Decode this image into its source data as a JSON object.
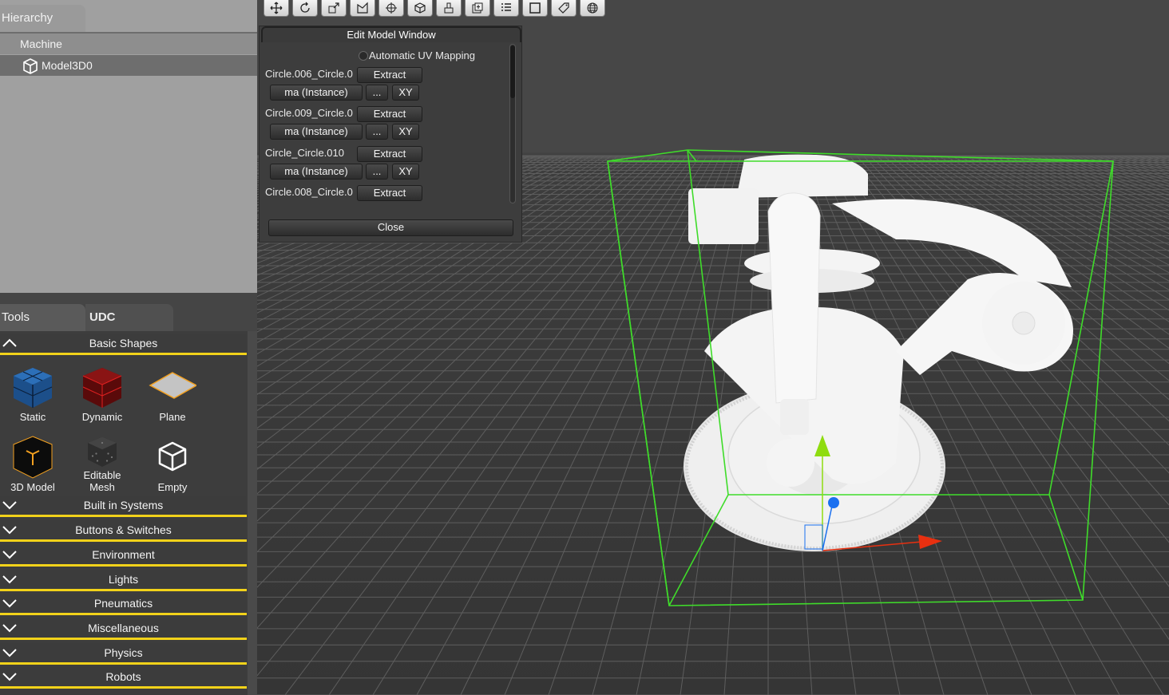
{
  "toolbar": {
    "tools": [
      {
        "icon": "move-icon"
      },
      {
        "icon": "rotate-icon"
      },
      {
        "icon": "scale-icon"
      },
      {
        "icon": "select-edit-icon"
      },
      {
        "icon": "pivot-icon"
      },
      {
        "icon": "cube-icon"
      },
      {
        "icon": "stamp-icon"
      },
      {
        "icon": "duplicate-icon"
      },
      {
        "icon": "list-icon"
      },
      {
        "icon": "frame-icon"
      },
      {
        "icon": "tag-icon"
      },
      {
        "icon": "globe-icon"
      }
    ]
  },
  "hierarchy": {
    "tab_label": "Hierarchy",
    "items": [
      {
        "label": "Machine"
      },
      {
        "label": "Model3D0"
      }
    ]
  },
  "tools_panel": {
    "tabs": [
      "Tools",
      "UDC"
    ],
    "basic_shapes_label": "Basic Shapes",
    "shapes": [
      {
        "label": "Static",
        "icon": "static-cube-icon",
        "color": "#1c4f8a"
      },
      {
        "label": "Dynamic",
        "icon": "dynamic-cube-icon",
        "color": "#7a1010"
      },
      {
        "label": "Plane",
        "icon": "plane-icon",
        "color": "#c4c4c4"
      },
      {
        "label": "3D Model",
        "icon": "model-cube-icon",
        "color": "#f2a020"
      },
      {
        "label": "Editable Mesh",
        "icon": "mesh-cube-icon",
        "color": "#444444"
      },
      {
        "label": "Empty",
        "icon": "empty-cube-icon",
        "color": "#ffffff"
      }
    ],
    "categories": [
      "Built in Systems",
      "Buttons & Switches",
      "Environment",
      "Lights",
      "Pneumatics",
      "Miscellaneous",
      "Physics",
      "Robots"
    ],
    "accent_color": "#f2d21a"
  },
  "edit_window": {
    "title": "Edit Model Window",
    "auto_uv_label": "Automatic UV Mapping",
    "entries": [
      {
        "name": "Circle.006_Circle.0",
        "extract": "Extract",
        "material": "ma (Instance)",
        "dots": "...",
        "xy": "XY"
      },
      {
        "name": "Circle.009_Circle.0",
        "extract": "Extract",
        "material": "ma (Instance)",
        "dots": "...",
        "xy": "XY"
      },
      {
        "name": "Circle_Circle.010",
        "extract": "Extract",
        "material": "ma (Instance)",
        "dots": "...",
        "xy": "XY"
      },
      {
        "name": "Circle.008_Circle.0",
        "extract": "Extract"
      }
    ],
    "close_label": "Close"
  },
  "viewport": {
    "bounding_box_color": "#3fdc2a",
    "gizmo": {
      "x_color": "#e83010",
      "y_color": "#8fdc10",
      "z_color": "#1a70f0"
    }
  }
}
